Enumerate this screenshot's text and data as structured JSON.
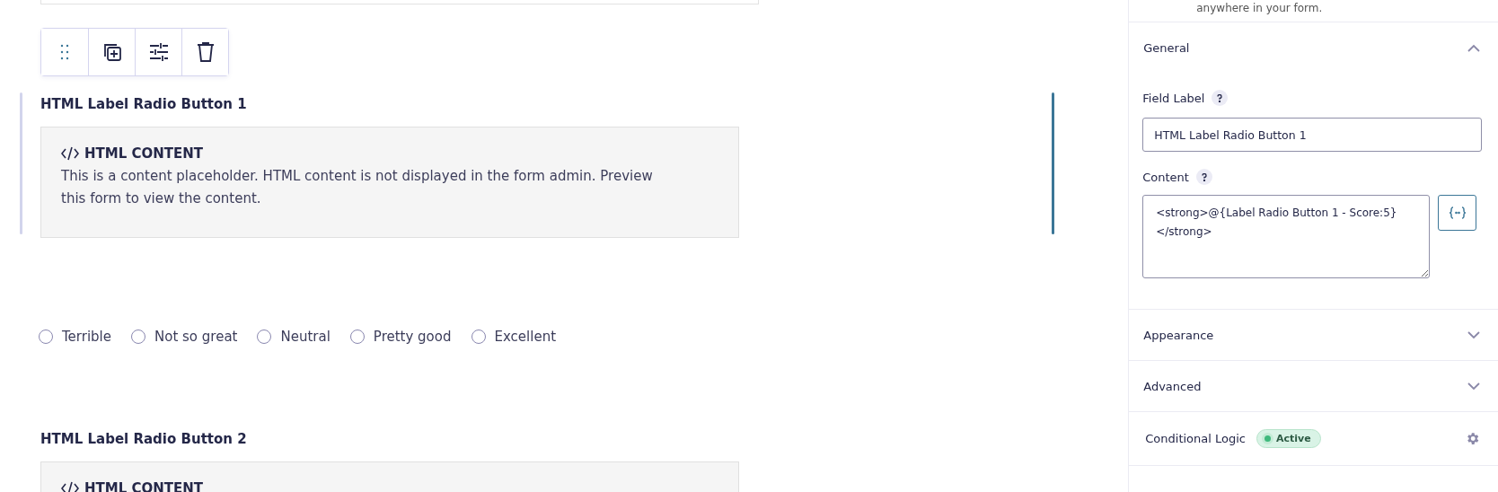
{
  "canvas": {
    "toolbar": [
      {
        "kind": "drag"
      },
      {
        "kind": "duplicate"
      },
      {
        "kind": "settings"
      },
      {
        "kind": "delete"
      }
    ],
    "fields": [
      {
        "kind": "html",
        "label": "HTML Label Radio Button 1",
        "selected": true,
        "heading": "HTML CONTENT",
        "text": "This is a content placeholder. HTML content is not displayed in the form admin. Preview this form to view the content."
      },
      {
        "kind": "radio",
        "options": [
          {
            "label": "Terrible",
            "selected": false
          },
          {
            "label": "Not so great",
            "selected": false
          },
          {
            "label": "Neutral",
            "selected": false
          },
          {
            "label": "Pretty good",
            "selected": false
          },
          {
            "label": "Excellent",
            "selected": false
          }
        ]
      },
      {
        "kind": "html",
        "label": "HTML Label Radio Button 2",
        "selected": false,
        "heading": "HTML CONTENT"
      }
    ]
  },
  "sidebar": {
    "top_note": "anywhere in your form.",
    "sections": [
      {
        "title": "General",
        "expanded": true,
        "settings": [
          {
            "label": "Field Label",
            "kind": "input",
            "value": "HTML Label Radio Button 1"
          },
          {
            "label": "Content",
            "kind": "textarea",
            "value": "<strong>@{Label Radio Button 1 - Score:5}\n</strong>"
          }
        ]
      },
      {
        "title": "Appearance",
        "expanded": false
      },
      {
        "title": "Advanced",
        "expanded": false
      }
    ],
    "conditional_logic": {
      "label": "Conditional Logic",
      "badge": "Active",
      "active": true
    }
  }
}
